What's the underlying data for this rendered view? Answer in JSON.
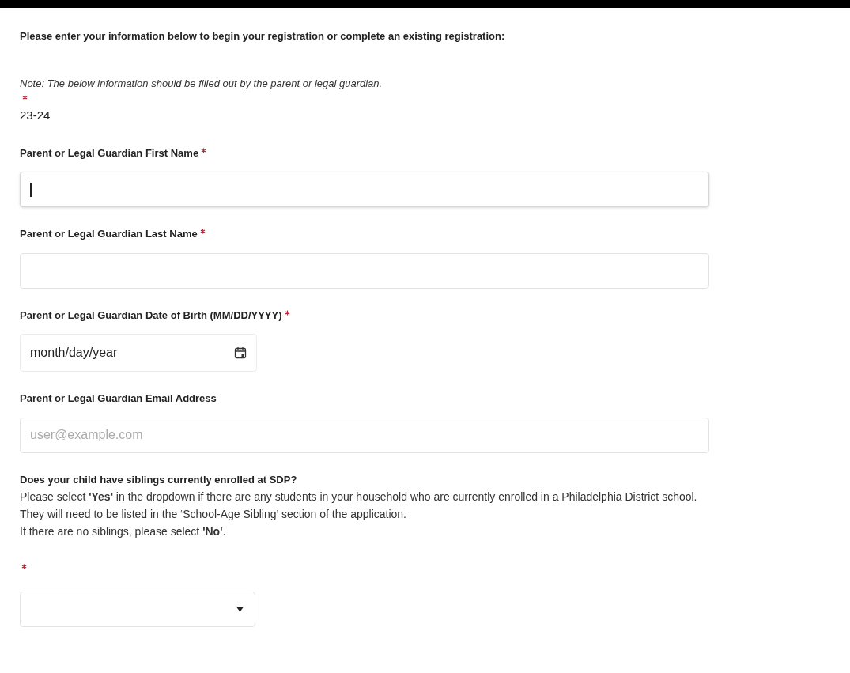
{
  "intro": "Please enter your information below to begin your registration or complete an existing registration:",
  "note": "Note: The below information should be filled out by the parent or legal guardian.",
  "fields": [
    {
      "kind": "static",
      "required": true,
      "value": "23-24"
    },
    {
      "kind": "text",
      "label": "Parent or Legal Guardian First Name",
      "required": true,
      "focused": true
    },
    {
      "kind": "text",
      "label": "Parent or Legal Guardian Last Name",
      "required": true,
      "focused": false
    },
    {
      "kind": "date",
      "label": "Parent or Legal Guardian Date of Birth (MM/DD/YYYY)",
      "required": true,
      "placeholder": "month/day/year"
    },
    {
      "kind": "email",
      "label": "Parent or Legal Guardian Email Address",
      "required": false,
      "placeholder": "user@example.com"
    },
    {
      "kind": "select",
      "label": "Does your child have siblings currently enrolled at SDP?",
      "help": [
        "Please select **'Yes'** in the dropdown if there are any students in your household who are currently enrolled in a Philadelphia District school. They will need to be listed in the ‘School-Age Sibling’ section of the application.",
        "If there are no siblings, please select **'No'**."
      ],
      "required": true
    }
  ]
}
